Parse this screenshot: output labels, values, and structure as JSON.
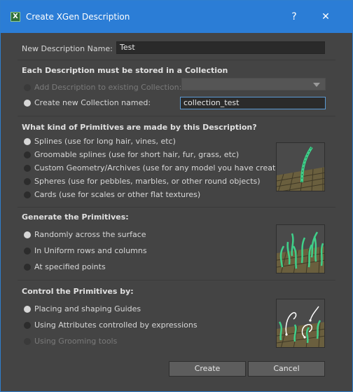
{
  "window": {
    "title": "Create XGen Description"
  },
  "titlebar": {
    "help": "?",
    "close": "✕",
    "app_icon": "X"
  },
  "name_field": {
    "label": "New Description Name:",
    "value": "Test"
  },
  "collection": {
    "heading": "Each Description must be stored in a Collection",
    "existing_label": "Add Description to existing Collection:",
    "existing_value": "",
    "new_label": "Create new Collection named:",
    "new_value": "collection_test"
  },
  "primitives": {
    "heading": "What kind of Primitives are made by this Description?",
    "options": [
      "Splines (use for long hair, vines, etc)",
      "Groomable splines (use for short hair, fur, grass, etc)",
      "Custom Geometry/Archives (use for any model you have created)",
      "Spheres (use for pebbles, marbles, or other round objects)",
      "Cards (use for scales or other flat textures)"
    ],
    "selected": 0
  },
  "generate": {
    "heading": "Generate the Primitives:",
    "options": [
      "Randomly across the surface",
      "In Uniform rows and columns",
      "At specified points"
    ],
    "selected": 0
  },
  "control": {
    "heading": "Control the Primitives by:",
    "options": [
      "Placing and shaping Guides",
      "Using Attributes controlled by expressions",
      "Using Grooming tools"
    ],
    "selected": 0,
    "disabled": [
      2
    ]
  },
  "buttons": {
    "create": "Create",
    "cancel": "Cancel"
  },
  "colors": {
    "accent": "#2b7dd6",
    "hair": "#3fd08a",
    "grid": "#5a5236"
  }
}
